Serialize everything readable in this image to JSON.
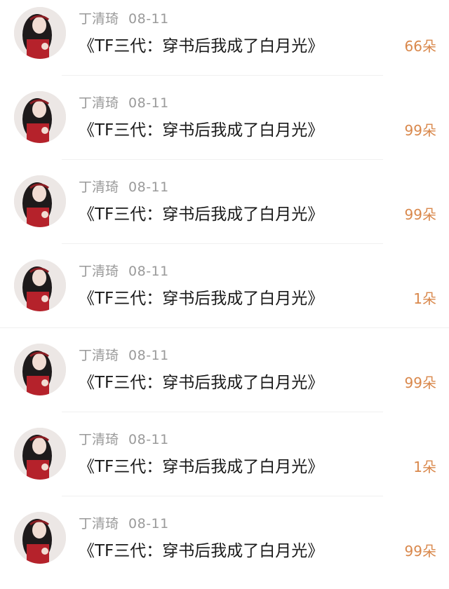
{
  "gifts": [
    {
      "user": "丁清琦",
      "date": "08-11",
      "work": "《TF三代：穿书后我成了白月光》",
      "amount": "66朵"
    },
    {
      "user": "丁清琦",
      "date": "08-11",
      "work": "《TF三代：穿书后我成了白月光》",
      "amount": "99朵"
    },
    {
      "user": "丁清琦",
      "date": "08-11",
      "work": "《TF三代：穿书后我成了白月光》",
      "amount": "99朵"
    },
    {
      "user": "丁清琦",
      "date": "08-11",
      "work": "《TF三代：穿书后我成了白月光》",
      "amount": "1朵"
    },
    {
      "user": "丁清琦",
      "date": "08-11",
      "work": "《TF三代：穿书后我成了白月光》",
      "amount": "99朵"
    },
    {
      "user": "丁清琦",
      "date": "08-11",
      "work": "《TF三代：穿书后我成了白月光》",
      "amount": "1朵"
    },
    {
      "user": "丁清琦",
      "date": "08-11",
      "work": "《TF三代：穿书后我成了白月光》",
      "amount": "99朵"
    }
  ],
  "colors": {
    "name_text": "#9a9a9a",
    "title_text": "#1a1a1a",
    "amount_text": "#d9884c",
    "avatar_dress": "#b5222b"
  }
}
